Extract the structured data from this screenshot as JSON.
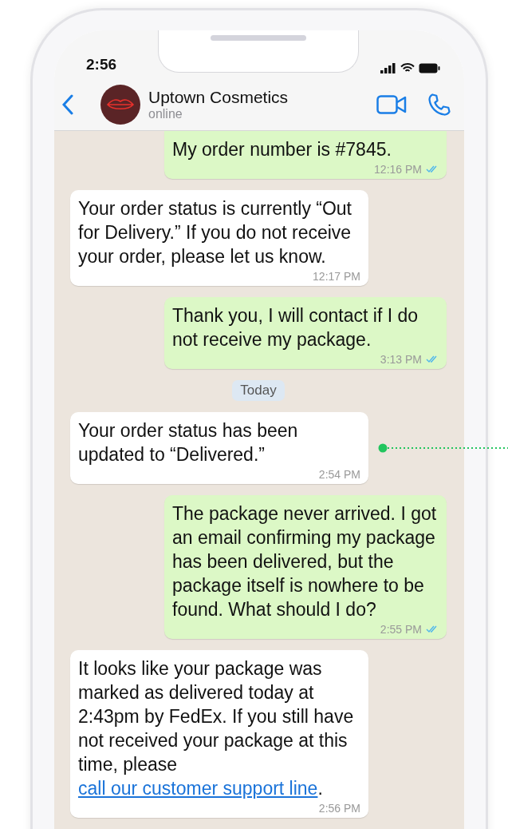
{
  "status_bar": {
    "time": "2:56"
  },
  "header": {
    "name": "Uptown Cosmetics",
    "status": "online"
  },
  "messages": [
    {
      "kind": "outgoing",
      "text": "My order number is #7845.",
      "time": "12:16 PM",
      "read": true
    },
    {
      "kind": "incoming",
      "text": "Your order status is currently “Out for Delivery.” If you do not receive your order, please let us know.",
      "time": "12:17 PM"
    },
    {
      "kind": "outgoing",
      "text": "Thank you, I will contact if I do not receive my package.",
      "time": "3:13 PM",
      "read": true
    },
    {
      "kind": "date",
      "text": "Today"
    },
    {
      "kind": "incoming",
      "text": "Your order status has been updated to “Delivered.”",
      "time": "2:54 PM",
      "pointer": true
    },
    {
      "kind": "outgoing",
      "text": "The package never arrived. I got an email confirming my package has been delivered, but the package itself is nowhere to be found. What should I do?",
      "time": "2:55 PM",
      "read": true
    },
    {
      "kind": "incoming",
      "text": "It looks like your package was marked as delivered today at 2:43pm by FedEx. If you still have not received your package at this time, please ",
      "link": "call our customer support line",
      "after": ".",
      "time": "2:56 PM"
    }
  ]
}
